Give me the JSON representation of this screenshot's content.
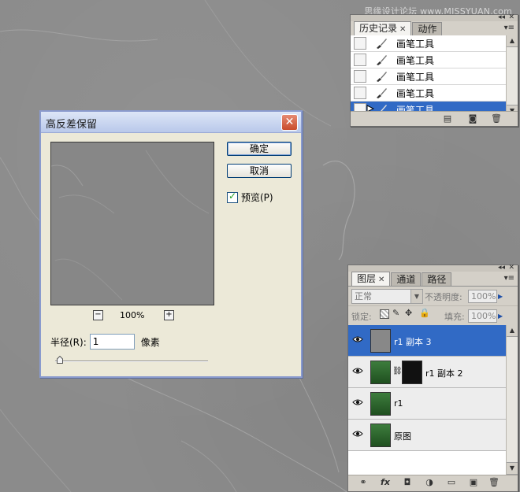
{
  "watermark": "思缘设计论坛 www.MISSYUAN.com",
  "history_panel": {
    "tabs": [
      {
        "label": "历史记录"
      },
      {
        "label": "动作"
      }
    ],
    "items": [
      {
        "label": "画笔工具",
        "active": false
      },
      {
        "label": "画笔工具",
        "active": false
      },
      {
        "label": "画笔工具",
        "active": false
      },
      {
        "label": "画笔工具",
        "active": false
      },
      {
        "label": "画笔工具",
        "active": true
      }
    ]
  },
  "dialog": {
    "title": "高反差保留",
    "ok_label": "确定",
    "cancel_label": "取消",
    "preview_label": "预览(P)",
    "preview_checked": true,
    "zoom": "100%",
    "radius_label": "半径(R):",
    "radius_value": "1",
    "unit_label": "像素"
  },
  "layers_panel": {
    "tabs": [
      {
        "label": "图层"
      },
      {
        "label": "通道"
      },
      {
        "label": "路径"
      }
    ],
    "blend_mode": "正常",
    "opacity_label": "不透明度:",
    "opacity_value": "100%",
    "lock_label": "锁定:",
    "fill_label": "填充:",
    "fill_value": "100%",
    "layers": [
      {
        "name": "r1 副本 3",
        "active": true
      },
      {
        "name": "r1 副本 2",
        "active": false
      },
      {
        "name": "r1",
        "active": false
      },
      {
        "name": "原图",
        "active": false
      }
    ]
  },
  "colors": {
    "selection": "#316ac5",
    "panel_bg": "#d4d0c8",
    "dialog_bg": "#ece9d8"
  }
}
